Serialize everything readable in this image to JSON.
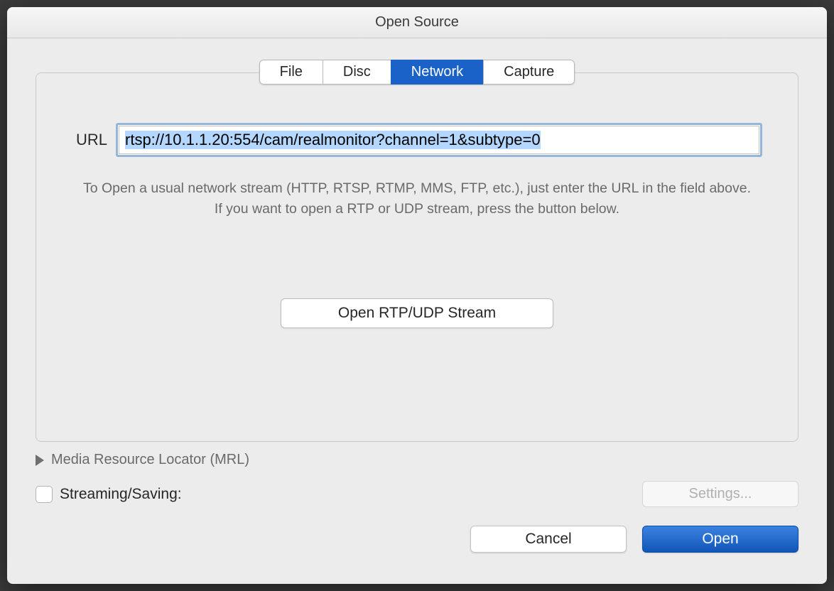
{
  "window": {
    "title": "Open Source"
  },
  "tabs": {
    "file": "File",
    "disc": "Disc",
    "network": "Network",
    "capture": "Capture",
    "active": "network"
  },
  "url": {
    "label": "URL",
    "value": "rtsp://10.1.1.20:554/cam/realmonitor?channel=1&subtype=0"
  },
  "help_text": "To Open a usual network stream (HTTP, RTSP, RTMP, MMS, FTP, etc.), just enter the URL in the field above. If you want to open a RTP or UDP stream, press the button below.",
  "buttons": {
    "rtp_udp": "Open RTP/UDP Stream",
    "settings": "Settings...",
    "cancel": "Cancel",
    "open": "Open"
  },
  "mrl": {
    "label": "Media Resource Locator (MRL)",
    "expanded": false
  },
  "streaming": {
    "label": "Streaming/Saving:",
    "checked": false
  }
}
